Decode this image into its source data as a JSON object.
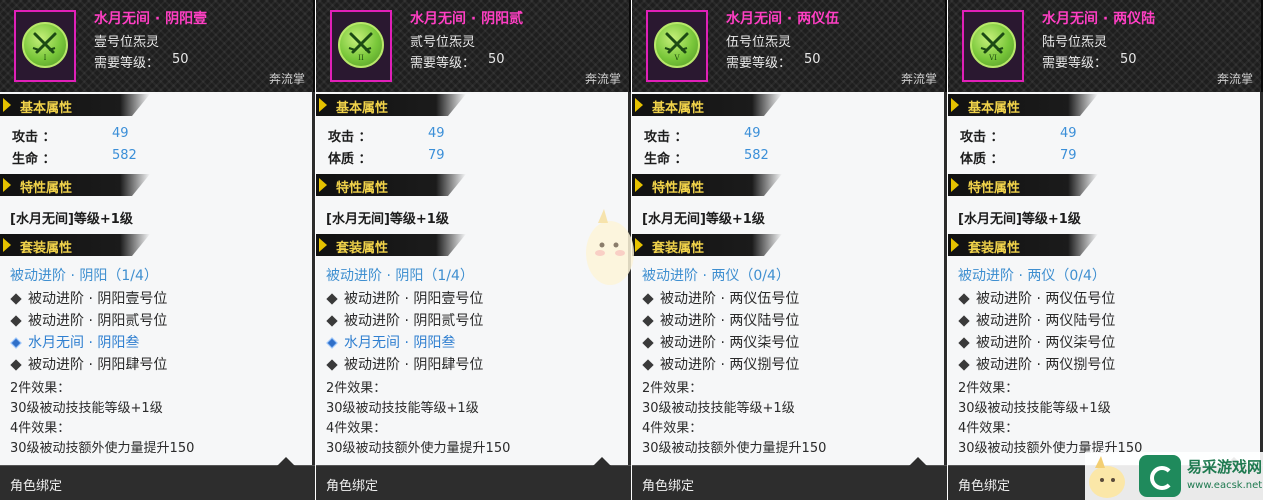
{
  "labels": {
    "required_level": "需要等级：",
    "skill_type": "奔流掌",
    "base_section": "基本属性",
    "trait_section": "特性属性",
    "set_section": "套装属性",
    "two_piece": "2件效果：",
    "four_piece": "4件效果：",
    "bind": "角色绑定"
  },
  "colors": {
    "title": "#ff3fc4",
    "stat_value": "#3b8fd8",
    "section_label": "#f0d24a",
    "icon_border": "#e020b8",
    "icon_fill": "#79c73a"
  },
  "panels": [
    {
      "title": "水月无间 · 阴阳壹",
      "subtitle": "壹号位炁灵",
      "numeral": "I",
      "required_level_value": "50",
      "stats": [
        {
          "label": "攻击 ：",
          "value": "49"
        },
        {
          "label": "生命 ：",
          "value": "582"
        }
      ],
      "trait": "[水月无间]等级+1级",
      "set_title": "被动进阶 · 阴阳（1/4）",
      "set_items": [
        {
          "text": "被动进阶 · 阴阳壹号位",
          "active": false
        },
        {
          "text": "被动进阶 · 阴阳贰号位",
          "active": false
        },
        {
          "text": "水月无间 · 阴阳叁",
          "active": true
        },
        {
          "text": "被动进阶 · 阴阳肆号位",
          "active": false
        }
      ],
      "two_piece_text": "30级被动技技能等级+1级",
      "four_piece_text": "30级被动技额外使力量提升150"
    },
    {
      "title": "水月无间 · 阴阳贰",
      "subtitle": "贰号位炁灵",
      "numeral": "II",
      "required_level_value": "50",
      "stats": [
        {
          "label": "攻击 ：",
          "value": "49"
        },
        {
          "label": "体质 ：",
          "value": "79"
        }
      ],
      "trait": "[水月无间]等级+1级",
      "set_title": "被动进阶 · 阴阳（1/4）",
      "set_items": [
        {
          "text": "被动进阶 · 阴阳壹号位",
          "active": false
        },
        {
          "text": "被动进阶 · 阴阳贰号位",
          "active": false
        },
        {
          "text": "水月无间 · 阴阳叁",
          "active": true
        },
        {
          "text": "被动进阶 · 阴阳肆号位",
          "active": false
        }
      ],
      "two_piece_text": "30级被动技技能等级+1级",
      "four_piece_text": "30级被动技额外使力量提升150"
    },
    {
      "title": "水月无间 · 两仪伍",
      "subtitle": "伍号位炁灵",
      "numeral": "V",
      "required_level_value": "50",
      "stats": [
        {
          "label": "攻击 ：",
          "value": "49"
        },
        {
          "label": "生命 ：",
          "value": "582"
        }
      ],
      "trait": "[水月无间]等级+1级",
      "set_title": "被动进阶 · 两仪（0/4）",
      "set_items": [
        {
          "text": "被动进阶 · 两仪伍号位",
          "active": false
        },
        {
          "text": "被动进阶 · 两仪陆号位",
          "active": false
        },
        {
          "text": "被动进阶 · 两仪柒号位",
          "active": false
        },
        {
          "text": "被动进阶 · 两仪捌号位",
          "active": false
        }
      ],
      "two_piece_text": "30级被动技技能等级+1级",
      "four_piece_text": "30级被动技额外使力量提升150"
    },
    {
      "title": "水月无间 · 两仪陆",
      "subtitle": "陆号位炁灵",
      "numeral": "VI",
      "required_level_value": "50",
      "stats": [
        {
          "label": "攻击 ：",
          "value": "49"
        },
        {
          "label": "体质 ：",
          "value": "79"
        }
      ],
      "trait": "[水月无间]等级+1级",
      "set_title": "被动进阶 · 两仪（0/4）",
      "set_items": [
        {
          "text": "被动进阶 · 两仪伍号位",
          "active": false
        },
        {
          "text": "被动进阶 · 两仪陆号位",
          "active": false
        },
        {
          "text": "被动进阶 · 两仪柒号位",
          "active": false
        },
        {
          "text": "被动进阶 · 两仪捌号位",
          "active": false
        }
      ],
      "two_piece_text": "30级被动技技能等级+1级",
      "four_piece_text": "30级被动技额外使力量提升150"
    }
  ],
  "watermark": {
    "site_name": "易采游戏网",
    "url": "www.eacsk.net"
  }
}
